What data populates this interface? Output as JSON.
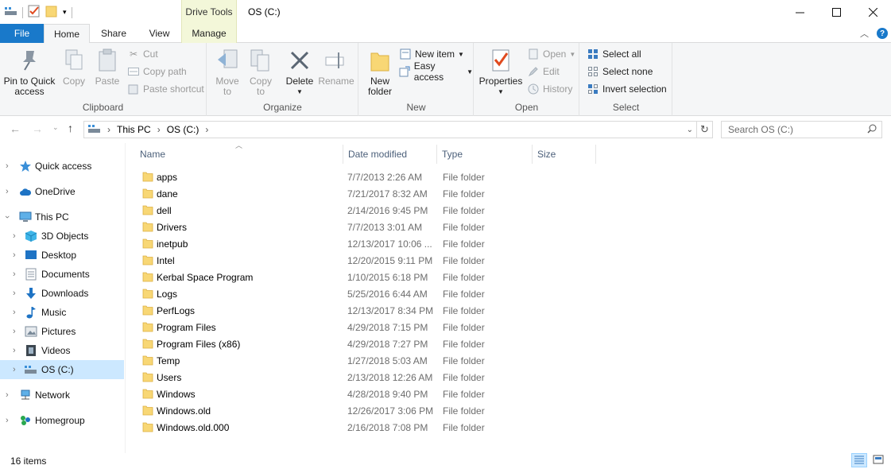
{
  "window": {
    "title": "OS (C:)",
    "context_tab": "Drive Tools",
    "controls": {
      "minimize": "—",
      "maximize": "☐",
      "close": "✕"
    }
  },
  "ribbon_tabs": [
    "File",
    "Home",
    "Share",
    "View",
    "Manage"
  ],
  "ribbon": {
    "clipboard": {
      "label": "Clipboard",
      "pin": "Pin to Quick access",
      "pin_line1": "Pin to Quick",
      "pin_line2": "access",
      "copy": "Copy",
      "paste": "Paste",
      "cut": "Cut",
      "copy_path": "Copy path",
      "paste_shortcut": "Paste shortcut"
    },
    "organize": {
      "label": "Organize",
      "move_to_1": "Move",
      "move_to_2": "to",
      "copy_to_1": "Copy",
      "copy_to_2": "to",
      "delete": "Delete",
      "rename": "Rename"
    },
    "new": {
      "label": "New",
      "new_folder_1": "New",
      "new_folder_2": "folder",
      "new_item": "New item",
      "easy_access": "Easy access"
    },
    "open": {
      "label": "Open",
      "properties": "Properties",
      "open": "Open",
      "edit": "Edit",
      "history": "History"
    },
    "select": {
      "label": "Select",
      "select_all": "Select all",
      "select_none": "Select none",
      "invert_selection": "Invert selection"
    }
  },
  "address": {
    "crumbs": [
      "This PC",
      "OS (C:)"
    ],
    "search_placeholder": "Search OS (C:)"
  },
  "nav": [
    {
      "label": "Quick access",
      "icon": "star-icon"
    },
    {
      "label": "OneDrive",
      "icon": "cloud-icon"
    },
    {
      "label": "This PC",
      "icon": "computer-icon"
    },
    {
      "label": "3D Objects",
      "icon": "cube-icon"
    },
    {
      "label": "Desktop",
      "icon": "desktop-icon"
    },
    {
      "label": "Documents",
      "icon": "documents-icon"
    },
    {
      "label": "Downloads",
      "icon": "download-icon"
    },
    {
      "label": "Music",
      "icon": "music-icon"
    },
    {
      "label": "Pictures",
      "icon": "pictures-icon"
    },
    {
      "label": "Videos",
      "icon": "video-icon"
    },
    {
      "label": "OS (C:)",
      "icon": "drive-icon"
    },
    {
      "label": "Network",
      "icon": "network-icon"
    },
    {
      "label": "Homegroup",
      "icon": "homegroup-icon"
    }
  ],
  "columns": {
    "name": "Name",
    "date": "Date modified",
    "type": "Type",
    "size": "Size"
  },
  "files": [
    {
      "name": "apps",
      "date": "7/7/2013 2:26 AM",
      "type": "File folder"
    },
    {
      "name": "dane",
      "date": "7/21/2017 8:32 AM",
      "type": "File folder"
    },
    {
      "name": "dell",
      "date": "2/14/2016 9:45 PM",
      "type": "File folder"
    },
    {
      "name": "Drivers",
      "date": "7/7/2013 3:01 AM",
      "type": "File folder"
    },
    {
      "name": "inetpub",
      "date": "12/13/2017 10:06 ...",
      "type": "File folder"
    },
    {
      "name": "Intel",
      "date": "12/20/2015 9:11 PM",
      "type": "File folder"
    },
    {
      "name": "Kerbal Space Program",
      "date": "1/10/2015 6:18 PM",
      "type": "File folder"
    },
    {
      "name": "Logs",
      "date": "5/25/2016 6:44 AM",
      "type": "File folder"
    },
    {
      "name": "PerfLogs",
      "date": "12/13/2017 8:34 PM",
      "type": "File folder"
    },
    {
      "name": "Program Files",
      "date": "4/29/2018 7:15 PM",
      "type": "File folder"
    },
    {
      "name": "Program Files (x86)",
      "date": "4/29/2018 7:27 PM",
      "type": "File folder"
    },
    {
      "name": "Temp",
      "date": "1/27/2018 5:03 AM",
      "type": "File folder"
    },
    {
      "name": "Users",
      "date": "2/13/2018 12:26 AM",
      "type": "File folder"
    },
    {
      "name": "Windows",
      "date": "4/28/2018 9:40 PM",
      "type": "File folder"
    },
    {
      "name": "Windows.old",
      "date": "12/26/2017 3:06 PM",
      "type": "File folder"
    },
    {
      "name": "Windows.old.000",
      "date": "2/16/2018 7:08 PM",
      "type": "File folder"
    }
  ],
  "status": {
    "count": "16 items"
  },
  "colors": {
    "file_tab": "#1979ca",
    "selection": "#cce8ff",
    "folder": "#f8d775"
  }
}
